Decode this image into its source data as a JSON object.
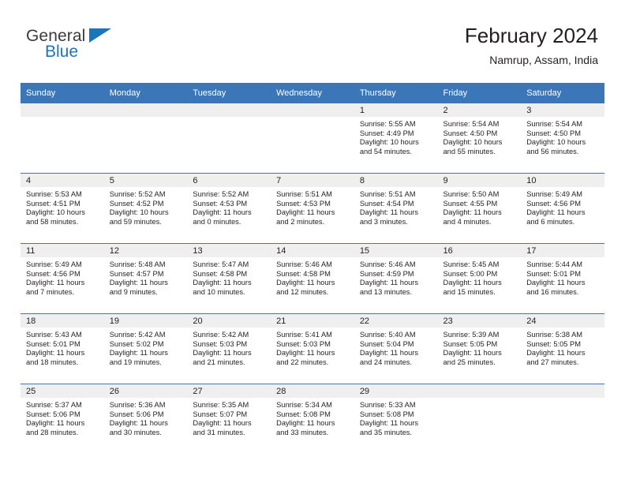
{
  "brand": {
    "name_part1": "General",
    "name_part2": "Blue",
    "triangle_color": "#1b75bb"
  },
  "header": {
    "title": "February 2024",
    "location": "Namrup, Assam, India"
  },
  "theme": {
    "header_blue": "#3a76b8",
    "daynum_band": "#efeff0",
    "text": "#231f20"
  },
  "weekday_headers": [
    "Sunday",
    "Monday",
    "Tuesday",
    "Wednesday",
    "Thursday",
    "Friday",
    "Saturday"
  ],
  "weeks": [
    [
      {
        "day": "",
        "sunrise": "",
        "sunset": "",
        "daylight1": "",
        "daylight2": ""
      },
      {
        "day": "",
        "sunrise": "",
        "sunset": "",
        "daylight1": "",
        "daylight2": ""
      },
      {
        "day": "",
        "sunrise": "",
        "sunset": "",
        "daylight1": "",
        "daylight2": ""
      },
      {
        "day": "",
        "sunrise": "",
        "sunset": "",
        "daylight1": "",
        "daylight2": ""
      },
      {
        "day": "1",
        "sunrise": "Sunrise: 5:55 AM",
        "sunset": "Sunset: 4:49 PM",
        "daylight1": "Daylight: 10 hours",
        "daylight2": "and 54 minutes."
      },
      {
        "day": "2",
        "sunrise": "Sunrise: 5:54 AM",
        "sunset": "Sunset: 4:50 PM",
        "daylight1": "Daylight: 10 hours",
        "daylight2": "and 55 minutes."
      },
      {
        "day": "3",
        "sunrise": "Sunrise: 5:54 AM",
        "sunset": "Sunset: 4:50 PM",
        "daylight1": "Daylight: 10 hours",
        "daylight2": "and 56 minutes."
      }
    ],
    [
      {
        "day": "4",
        "sunrise": "Sunrise: 5:53 AM",
        "sunset": "Sunset: 4:51 PM",
        "daylight1": "Daylight: 10 hours",
        "daylight2": "and 58 minutes."
      },
      {
        "day": "5",
        "sunrise": "Sunrise: 5:52 AM",
        "sunset": "Sunset: 4:52 PM",
        "daylight1": "Daylight: 10 hours",
        "daylight2": "and 59 minutes."
      },
      {
        "day": "6",
        "sunrise": "Sunrise: 5:52 AM",
        "sunset": "Sunset: 4:53 PM",
        "daylight1": "Daylight: 11 hours",
        "daylight2": "and 0 minutes."
      },
      {
        "day": "7",
        "sunrise": "Sunrise: 5:51 AM",
        "sunset": "Sunset: 4:53 PM",
        "daylight1": "Daylight: 11 hours",
        "daylight2": "and 2 minutes."
      },
      {
        "day": "8",
        "sunrise": "Sunrise: 5:51 AM",
        "sunset": "Sunset: 4:54 PM",
        "daylight1": "Daylight: 11 hours",
        "daylight2": "and 3 minutes."
      },
      {
        "day": "9",
        "sunrise": "Sunrise: 5:50 AM",
        "sunset": "Sunset: 4:55 PM",
        "daylight1": "Daylight: 11 hours",
        "daylight2": "and 4 minutes."
      },
      {
        "day": "10",
        "sunrise": "Sunrise: 5:49 AM",
        "sunset": "Sunset: 4:56 PM",
        "daylight1": "Daylight: 11 hours",
        "daylight2": "and 6 minutes."
      }
    ],
    [
      {
        "day": "11",
        "sunrise": "Sunrise: 5:49 AM",
        "sunset": "Sunset: 4:56 PM",
        "daylight1": "Daylight: 11 hours",
        "daylight2": "and 7 minutes."
      },
      {
        "day": "12",
        "sunrise": "Sunrise: 5:48 AM",
        "sunset": "Sunset: 4:57 PM",
        "daylight1": "Daylight: 11 hours",
        "daylight2": "and 9 minutes."
      },
      {
        "day": "13",
        "sunrise": "Sunrise: 5:47 AM",
        "sunset": "Sunset: 4:58 PM",
        "daylight1": "Daylight: 11 hours",
        "daylight2": "and 10 minutes."
      },
      {
        "day": "14",
        "sunrise": "Sunrise: 5:46 AM",
        "sunset": "Sunset: 4:58 PM",
        "daylight1": "Daylight: 11 hours",
        "daylight2": "and 12 minutes."
      },
      {
        "day": "15",
        "sunrise": "Sunrise: 5:46 AM",
        "sunset": "Sunset: 4:59 PM",
        "daylight1": "Daylight: 11 hours",
        "daylight2": "and 13 minutes."
      },
      {
        "day": "16",
        "sunrise": "Sunrise: 5:45 AM",
        "sunset": "Sunset: 5:00 PM",
        "daylight1": "Daylight: 11 hours",
        "daylight2": "and 15 minutes."
      },
      {
        "day": "17",
        "sunrise": "Sunrise: 5:44 AM",
        "sunset": "Sunset: 5:01 PM",
        "daylight1": "Daylight: 11 hours",
        "daylight2": "and 16 minutes."
      }
    ],
    [
      {
        "day": "18",
        "sunrise": "Sunrise: 5:43 AM",
        "sunset": "Sunset: 5:01 PM",
        "daylight1": "Daylight: 11 hours",
        "daylight2": "and 18 minutes."
      },
      {
        "day": "19",
        "sunrise": "Sunrise: 5:42 AM",
        "sunset": "Sunset: 5:02 PM",
        "daylight1": "Daylight: 11 hours",
        "daylight2": "and 19 minutes."
      },
      {
        "day": "20",
        "sunrise": "Sunrise: 5:42 AM",
        "sunset": "Sunset: 5:03 PM",
        "daylight1": "Daylight: 11 hours",
        "daylight2": "and 21 minutes."
      },
      {
        "day": "21",
        "sunrise": "Sunrise: 5:41 AM",
        "sunset": "Sunset: 5:03 PM",
        "daylight1": "Daylight: 11 hours",
        "daylight2": "and 22 minutes."
      },
      {
        "day": "22",
        "sunrise": "Sunrise: 5:40 AM",
        "sunset": "Sunset: 5:04 PM",
        "daylight1": "Daylight: 11 hours",
        "daylight2": "and 24 minutes."
      },
      {
        "day": "23",
        "sunrise": "Sunrise: 5:39 AM",
        "sunset": "Sunset: 5:05 PM",
        "daylight1": "Daylight: 11 hours",
        "daylight2": "and 25 minutes."
      },
      {
        "day": "24",
        "sunrise": "Sunrise: 5:38 AM",
        "sunset": "Sunset: 5:05 PM",
        "daylight1": "Daylight: 11 hours",
        "daylight2": "and 27 minutes."
      }
    ],
    [
      {
        "day": "25",
        "sunrise": "Sunrise: 5:37 AM",
        "sunset": "Sunset: 5:06 PM",
        "daylight1": "Daylight: 11 hours",
        "daylight2": "and 28 minutes."
      },
      {
        "day": "26",
        "sunrise": "Sunrise: 5:36 AM",
        "sunset": "Sunset: 5:06 PM",
        "daylight1": "Daylight: 11 hours",
        "daylight2": "and 30 minutes."
      },
      {
        "day": "27",
        "sunrise": "Sunrise: 5:35 AM",
        "sunset": "Sunset: 5:07 PM",
        "daylight1": "Daylight: 11 hours",
        "daylight2": "and 31 minutes."
      },
      {
        "day": "28",
        "sunrise": "Sunrise: 5:34 AM",
        "sunset": "Sunset: 5:08 PM",
        "daylight1": "Daylight: 11 hours",
        "daylight2": "and 33 minutes."
      },
      {
        "day": "29",
        "sunrise": "Sunrise: 5:33 AM",
        "sunset": "Sunset: 5:08 PM",
        "daylight1": "Daylight: 11 hours",
        "daylight2": "and 35 minutes."
      },
      {
        "day": "",
        "sunrise": "",
        "sunset": "",
        "daylight1": "",
        "daylight2": ""
      },
      {
        "day": "",
        "sunrise": "",
        "sunset": "",
        "daylight1": "",
        "daylight2": ""
      }
    ]
  ]
}
